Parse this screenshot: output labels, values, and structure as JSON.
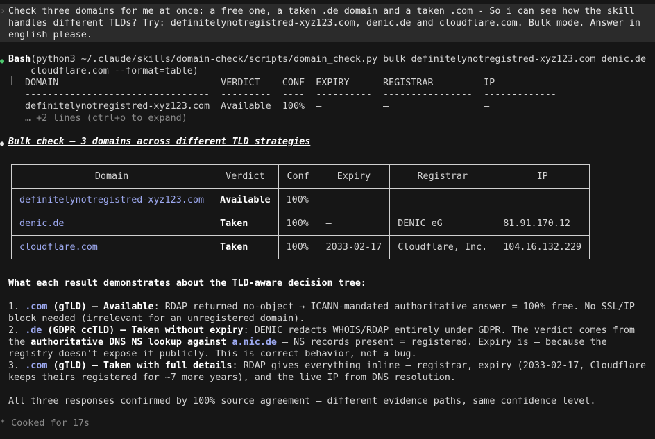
{
  "prompt": {
    "text": "Check three domains for me at once: a free one, a taken .de domain and a taken .com - So i can see how the skill handles different TLDs? Try: definitelynotregistred-xyz123.com, denic.de and cloudflare.com. Bulk mode. Answer in english please."
  },
  "bash": {
    "tool": "Bash",
    "command_line1": "(python3 ~/.claude/skills/domain-check/scripts/domain_check.py bulk definitelynotregistred-xyz123.com denic.de",
    "command_line2": "cloudflare.com --format=table)",
    "header_row": "DOMAIN                             VERDICT    CONF  EXPIRY      REGISTRAR         IP",
    "sep_row": "---------------------------------  ---------  ----  ----------  ----------------  -------------",
    "data_row": "definitelynotregistred-xyz123.com  Available  100%  —           —                 —",
    "more": "… +2 lines (ctrl+o to expand)"
  },
  "summary_heading": "Bulk check — 3 domains across different TLD strategies",
  "table": {
    "headers": [
      "Domain",
      "Verdict",
      "Conf",
      "Expiry",
      "Registrar",
      "IP"
    ],
    "rows": [
      [
        "definitelynotregistred-xyz123.com",
        "Available",
        "100%",
        "—",
        "—",
        "—"
      ],
      [
        "denic.de",
        "Taken",
        "100%",
        "—",
        "DENIC eG",
        "81.91.170.12"
      ],
      [
        "cloudflare.com",
        "Taken",
        "100%",
        "2033-02-17",
        "Cloudflare, Inc.",
        "104.16.132.229"
      ]
    ]
  },
  "explanation": {
    "heading": "What each result demonstrates about the TLD-aware decision tree:",
    "item1": {
      "num": "1. ",
      "tld": ".com",
      "label": " (gTLD) — Available",
      "text": ": RDAP returned no-object → ICANN-mandated authoritative answer = 100% free. No SSL/IP block needed (irrelevant for an unregistered domain)."
    },
    "item2": {
      "num": "2. ",
      "tld": ".de",
      "label": " (GDPR ccTLD) — Taken without expiry",
      "text_a": ": DENIC redacts WHOIS/RDAP entirely under GDPR. The verdict comes from the ",
      "bold_b": "authoritative DNS NS lookup against ",
      "link": "a.nic.de",
      "text_c": " — NS records present = registered. Expiry is — because the registry doesn't expose it publicly. This is correct behavior, not a bug."
    },
    "item3": {
      "num": "3. ",
      "tld": ".com",
      "label": " (gTLD) — Taken with full details",
      "text": ": RDAP gives everything inline — registrar, expiry (2033-02-17, Cloudflare keeps theirs registered for ~7 more years), and the live IP from DNS resolution."
    },
    "conclusion": "All three responses confirmed by 100% source agreement — different evidence paths, same confidence level."
  },
  "footer": {
    "icon": "asterisk-icon",
    "text": "Cooked for 17s"
  },
  "colors": {
    "background": "#161616",
    "prompt_bg": "#2b2b2b",
    "success": "#4ec96f",
    "link": "#9da9f0"
  }
}
